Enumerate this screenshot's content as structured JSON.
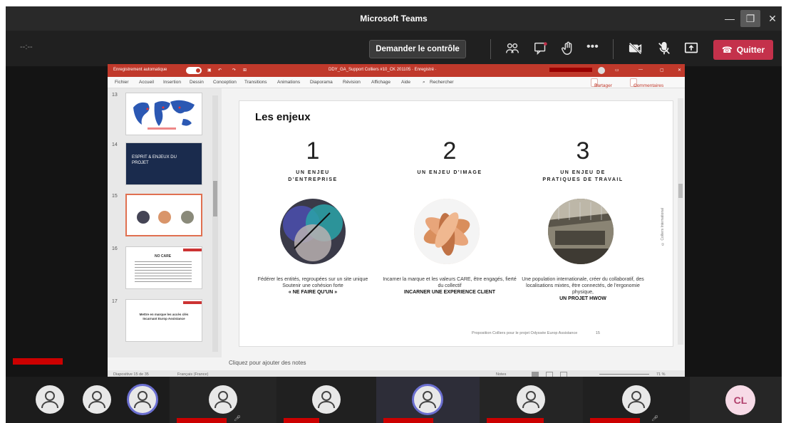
{
  "teams": {
    "title": "Microsoft Teams",
    "left_indicator": "--:--",
    "request_control": "Demander le contrôle",
    "quit": "Quitter",
    "colors": {
      "quit": "#c4314b",
      "avatar_ring": "#6b6fd0",
      "initials_bg": "#f7dbe7",
      "initials_fg": "#b0406c"
    }
  },
  "ppt": {
    "autosave": "Enregistrement automatique",
    "doc_title": "DDY_GA_Support Colliers #10_CK 201105 · Enregistré ·",
    "ribbon": [
      "Fichier",
      "Accueil",
      "Insertion",
      "Dessin",
      "Conception",
      "Transitions",
      "Animations",
      "Diaporama",
      "Révision",
      "Affichage",
      "Aide"
    ],
    "search": "Rechercher",
    "share": "Partager",
    "comments": "Commentaires",
    "thumbnails": [
      {
        "num": "13"
      },
      {
        "num": "14",
        "text": "ESPRIT & ENJEUX DU PROJET"
      },
      {
        "num": "15"
      },
      {
        "num": "16",
        "text": "NO CARE"
      },
      {
        "num": "17",
        "text": "Mettre en marque les accès clés Incarnant Europ Assistance"
      }
    ],
    "notes_placeholder": "Cliquez pour ajouter des notes",
    "status_left": "Diapositive 15 de 35",
    "status_lang": "Français (France)",
    "status_notes": "Notes",
    "status_zoom": "71 %"
  },
  "slide": {
    "title": "Les enjeux",
    "columns": [
      {
        "num": "1",
        "heading": "UN ENJEU\nD'ENTREPRISE",
        "text": "Fédérer les entités, regroupées sur un site unique\nSoutenir une cohésion forte",
        "bold": "« NE FAIRE QU'UN »"
      },
      {
        "num": "2",
        "heading": "UN ENJEU D'IMAGE",
        "text": "Incarner la marque et les valeurs CARE, être engagés, fierté du collectif",
        "bold": "INCARNER UNE EXPERIENCE CLIENT"
      },
      {
        "num": "3",
        "heading": "UN ENJEU DE\nPRATIQUES DE TRAVAIL",
        "text": "Une population internationale, créer du collaboratif, des localisations mixtes, être connectés, de l'ergonomie physique,",
        "bold": "UN PROJET HWOW"
      }
    ],
    "footer": "Proposition Colliers pour le projet Odyssée Europ Assistance",
    "page": "15",
    "vertical": "© Colliers International"
  },
  "participants": {
    "initials": "CL"
  }
}
